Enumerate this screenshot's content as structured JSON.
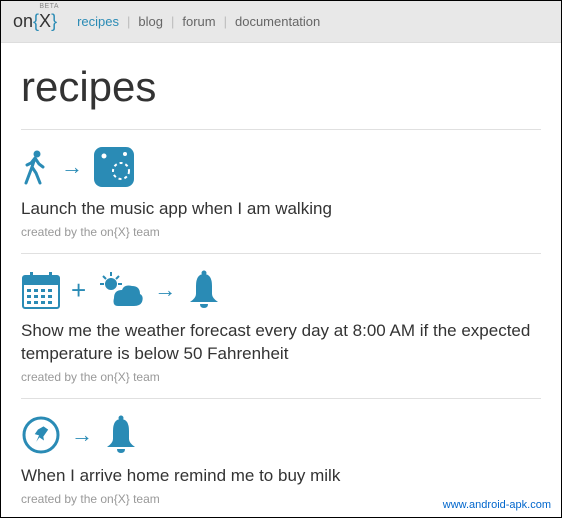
{
  "header": {
    "logo_on": "on",
    "logo_brace_open": "{",
    "logo_x": "X",
    "logo_brace_close": "}",
    "beta": "BETA",
    "nav": [
      {
        "label": "recipes",
        "active": true
      },
      {
        "label": "blog",
        "active": false
      },
      {
        "label": "forum",
        "active": false
      },
      {
        "label": "documentation",
        "active": false
      }
    ]
  },
  "page_title": "recipes",
  "recipes": [
    {
      "title": "Launch the music app when I am walking",
      "by": "created by the on{X} team"
    },
    {
      "title": "Show me the weather forecast every day at 8:00 AM if the expected temperature is below 50 Fahrenheit",
      "by": "created by the on{X} team"
    },
    {
      "title": "When I arrive home remind me to buy milk",
      "by": "created by the on{X} team"
    }
  ],
  "watermark": "www.android-apk.com"
}
